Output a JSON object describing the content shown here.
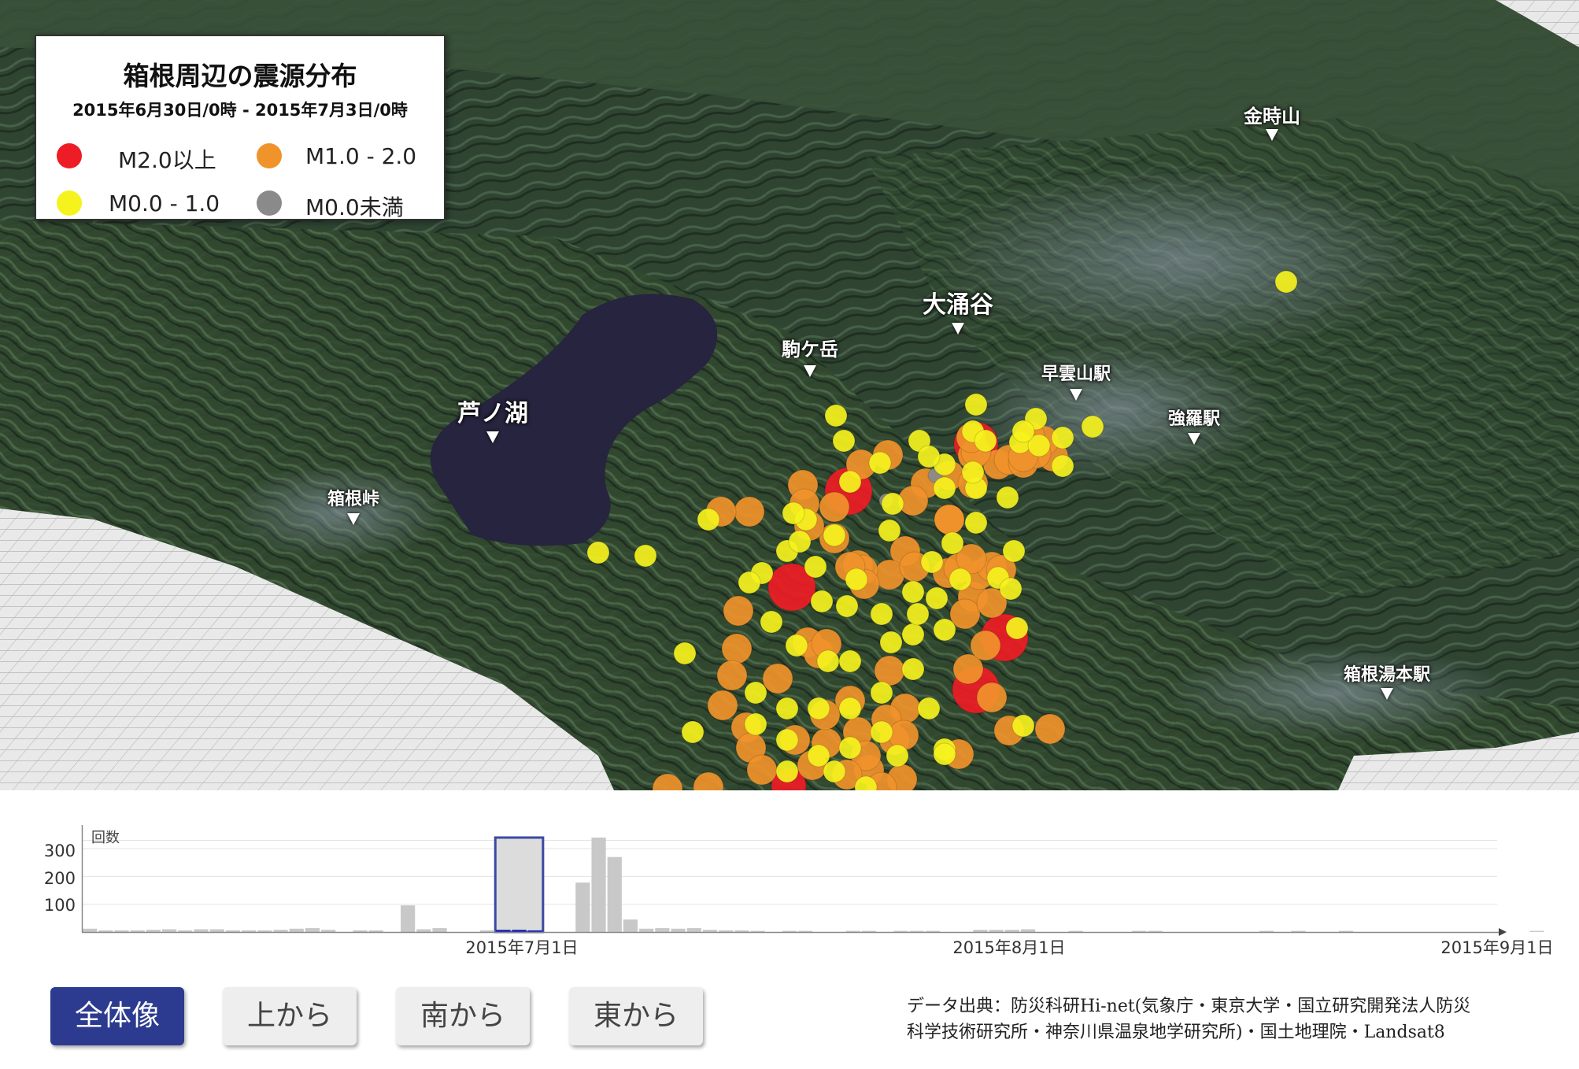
{
  "legend": {
    "title": "箱根周辺の震源分布",
    "date_range": "2015年6月30日/0時 - 2015年7月3日/0時",
    "items": [
      {
        "label": "M2.0以上",
        "color": "#ee1c25"
      },
      {
        "label": "M1.0 - 2.0",
        "color": "#f0932b"
      },
      {
        "label": "M0.0 - 1.0",
        "color": "#f5f21e"
      },
      {
        "label": "M0.0未満",
        "color": "#8a8a8a"
      }
    ]
  },
  "places": {
    "kintokisan": "金時山",
    "owakudani": "大涌谷",
    "komagatake": "駒ケ岳",
    "soun_station": "早雲山駅",
    "ashinoko": "芦ノ湖",
    "gora_station": "強羅駅",
    "hakone_toge": "箱根峠",
    "yumoto_station": "箱根湯本駅"
  },
  "chart_data": {
    "type": "bar",
    "ylabel": "回数",
    "yticks": [
      100,
      200,
      300
    ],
    "ylim": [
      0,
      340
    ],
    "x_start": "2015-06-04",
    "x_end": "2015-09-01",
    "xticks": [
      "2015年7月1日",
      "2015年8月1日",
      "2015年9月1日"
    ],
    "selected_range": [
      "2015-06-30",
      "2015-07-03"
    ],
    "values": [
      12,
      6,
      6,
      6,
      8,
      10,
      6,
      10,
      10,
      6,
      6,
      6,
      8,
      12,
      14,
      8,
      0,
      6,
      6,
      0,
      96,
      10,
      14,
      0,
      0,
      6,
      8,
      8,
      6,
      0,
      0,
      178,
      340,
      270,
      45,
      12,
      14,
      12,
      14,
      8,
      6,
      6,
      4,
      0,
      4,
      4,
      0,
      0,
      4,
      4,
      0,
      4,
      4,
      4,
      0,
      0,
      8,
      8,
      8,
      10,
      0,
      0,
      4,
      0,
      0,
      0,
      4,
      4,
      0,
      0,
      0,
      0,
      0,
      0,
      4,
      0,
      4,
      0,
      0,
      4,
      0,
      0,
      0,
      0,
      0,
      0,
      0,
      0,
      0,
      0,
      0,
      4,
      0,
      0,
      0,
      0,
      4,
      0,
      0,
      30,
      20,
      14
    ]
  },
  "buttons": {
    "overview": "全体像",
    "top": "上から",
    "south": "南から",
    "east": "東から"
  },
  "credit": {
    "line1": "データ出典：防災科研Hi-net(気象庁・東京大学・国立研究開発法人防災",
    "line2": "科学技術研究所・神奈川県温泉地学研究所)・国土地理院・Landsat8"
  }
}
